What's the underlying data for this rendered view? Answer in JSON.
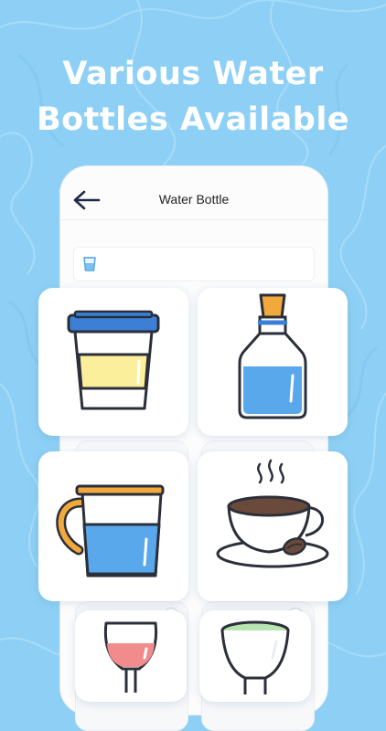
{
  "headline": {
    "line1": "Various Water",
    "line2": "Bottles Available"
  },
  "screen": {
    "title": "Water Bottle"
  },
  "colors": {
    "background": "#8ed0f5",
    "accent_blue": "#3b82d6",
    "water_blue": "#5aa8ec",
    "lid_orange": "#f2a93b",
    "sleeve_yellow": "#fbef9b",
    "wine_red": "#f28b8b",
    "tea_green": "#b7e4b0",
    "coffee_brown": "#6a4a3a"
  },
  "bottles": [
    {
      "name": "coffee-cup-icon"
    },
    {
      "name": "glass-bottle-icon"
    },
    {
      "name": "water-pitcher-icon"
    },
    {
      "name": "tea-cup-saucer-icon"
    },
    {
      "name": "wine-glass-icon"
    },
    {
      "name": "green-tea-cup-icon"
    }
  ]
}
